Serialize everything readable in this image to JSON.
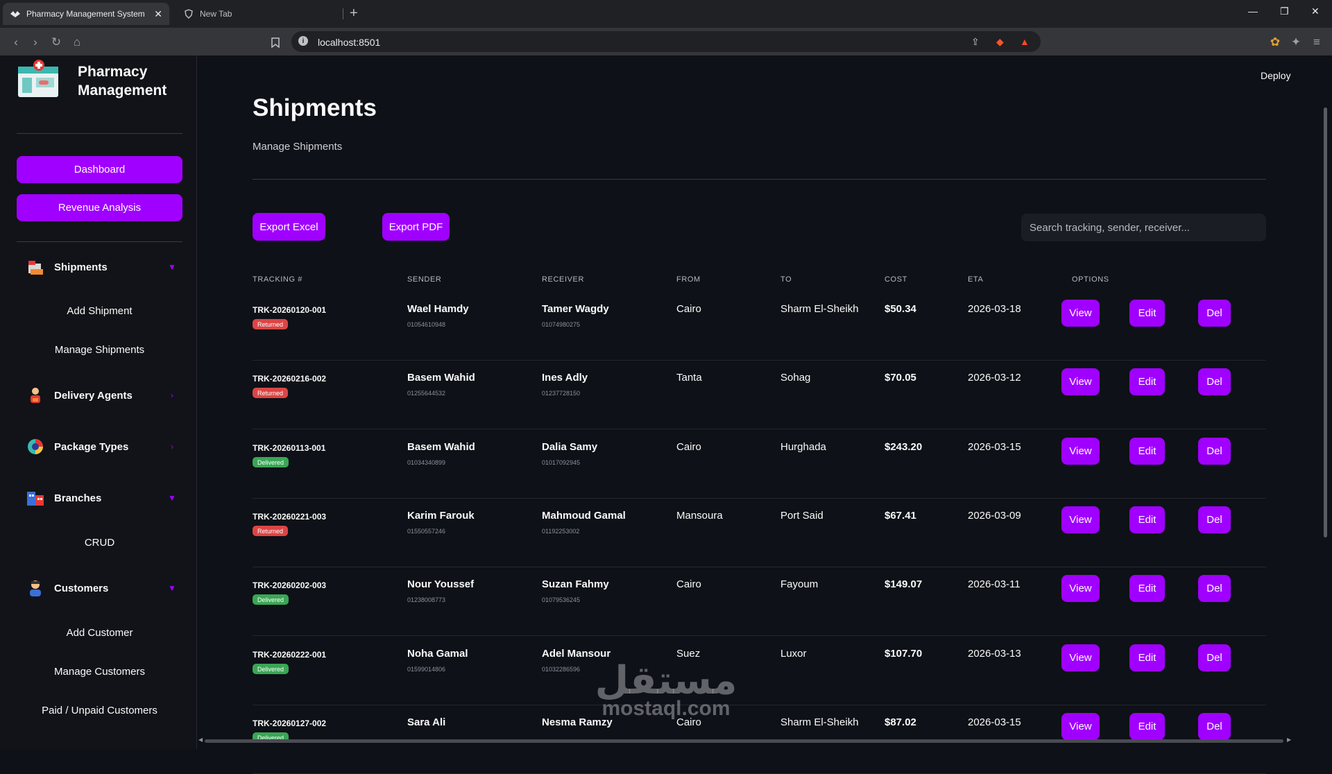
{
  "browser": {
    "active_tab": "Pharmacy Management System",
    "inactive_tab": "New Tab",
    "url": "localhost:8501"
  },
  "app": {
    "title": "Pharmacy Management",
    "deploy_label": "Deploy",
    "accent_color": "#a000ff"
  },
  "sidebar": {
    "dashboard_label": "Dashboard",
    "revenue_label": "Revenue Analysis",
    "sections": {
      "shipments": {
        "label": "Shipments",
        "arrow": "▼",
        "icon": "shipment-box-icon"
      },
      "delivery_agents": {
        "label": "Delivery Agents",
        "arrow": "›",
        "icon": "delivery-agent-icon"
      },
      "package_types": {
        "label": "Package Types",
        "arrow": "›",
        "icon": "package-types-icon"
      },
      "branches": {
        "label": "Branches",
        "arrow": "▼",
        "icon": "branches-icon"
      },
      "customers": {
        "label": "Customers",
        "arrow": "▼",
        "icon": "customer-icon"
      }
    },
    "shipments_sub": [
      "Add Shipment",
      "Manage Shipments"
    ],
    "branches_sub": [
      "CRUD"
    ],
    "customers_sub": [
      "Add Customer",
      "Manage Customers",
      "Paid / Unpaid Customers"
    ]
  },
  "page": {
    "title": "Shipments",
    "subtitle": "Manage Shipments",
    "export_excel": "Export Excel",
    "export_pdf": "Export PDF",
    "search_placeholder": "Search tracking, sender, receiver..."
  },
  "table": {
    "headers": [
      "TRACKING #",
      "SENDER",
      "RECEIVER",
      "FROM",
      "TO",
      "COST",
      "ETA",
      "OPTIONS"
    ],
    "action_labels": {
      "view": "View",
      "edit": "Edit",
      "del": "Del"
    },
    "status_colors": {
      "Returned": "#dc4545",
      "Delivered": "#3aa655"
    },
    "rows": [
      {
        "tracking": "TRK-20260120-001",
        "status": "Returned",
        "sender": "Wael Hamdy",
        "sender_phone": "01054610948",
        "receiver": "Tamer Wagdy",
        "receiver_phone": "01074980275",
        "from": "Cairo",
        "to": "Sharm El-Sheikh",
        "cost": "$50.34",
        "eta": "2026-03-18"
      },
      {
        "tracking": "TRK-20260216-002",
        "status": "Returned",
        "sender": "Basem Wahid",
        "sender_phone": "01255644532",
        "receiver": "Ines Adly",
        "receiver_phone": "01237728150",
        "from": "Tanta",
        "to": "Sohag",
        "cost": "$70.05",
        "eta": "2026-03-12"
      },
      {
        "tracking": "TRK-20260113-001",
        "status": "Delivered",
        "sender": "Basem Wahid",
        "sender_phone": "01034340899",
        "receiver": "Dalia Samy",
        "receiver_phone": "01017092945",
        "from": "Cairo",
        "to": "Hurghada",
        "cost": "$243.20",
        "eta": "2026-03-15"
      },
      {
        "tracking": "TRK-20260221-003",
        "status": "Returned",
        "sender": "Karim Farouk",
        "sender_phone": "01550557246",
        "receiver": "Mahmoud Gamal",
        "receiver_phone": "01192253002",
        "from": "Mansoura",
        "to": "Port Said",
        "cost": "$67.41",
        "eta": "2026-03-09"
      },
      {
        "tracking": "TRK-20260202-003",
        "status": "Delivered",
        "sender": "Nour Youssef",
        "sender_phone": "01238008773",
        "receiver": "Suzan Fahmy",
        "receiver_phone": "01079536245",
        "from": "Cairo",
        "to": "Fayoum",
        "cost": "$149.07",
        "eta": "2026-03-11"
      },
      {
        "tracking": "TRK-20260222-001",
        "status": "Delivered",
        "sender": "Noha Gamal",
        "sender_phone": "01599014806",
        "receiver": "Adel Mansour",
        "receiver_phone": "01032286596",
        "from": "Suez",
        "to": "Luxor",
        "cost": "$107.70",
        "eta": "2026-03-13"
      },
      {
        "tracking": "TRK-20260127-002",
        "status": "Delivered",
        "sender": "Sara Ali",
        "sender_phone": "",
        "receiver": "Nesma Ramzy",
        "receiver_phone": "",
        "from": "Cairo",
        "to": "Sharm El-Sheikh",
        "cost": "$87.02",
        "eta": "2026-03-15"
      }
    ]
  },
  "watermark": {
    "arabic": "مستقل",
    "latin": "mostaql.com"
  }
}
